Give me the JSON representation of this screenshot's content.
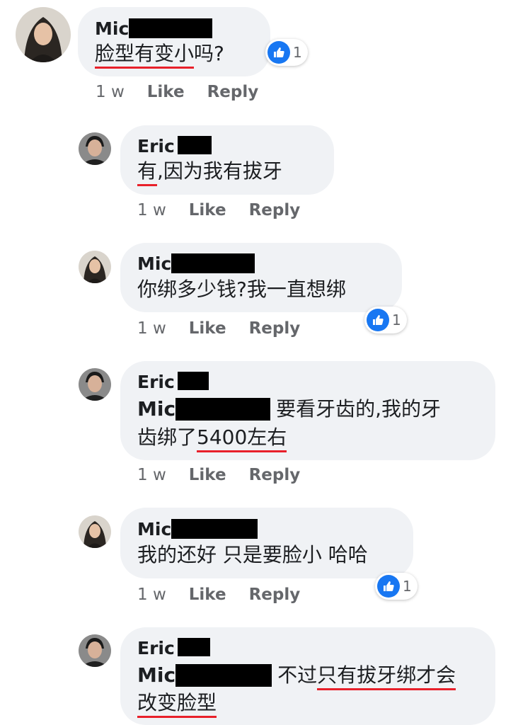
{
  "comments": [
    {
      "author": "Mic",
      "text_parts": [
        "脸型有变小",
        "吗?"
      ],
      "time": "1 w",
      "like": "Like",
      "reply": "Reply",
      "reactions": "1"
    },
    {
      "author": "Eric",
      "text_parts": [
        "有",
        ",因为我有拔牙"
      ],
      "time": "1 w",
      "like": "Like",
      "reply": "Reply"
    },
    {
      "author": "Mic",
      "text": "你绑多少钱?我一直想绑",
      "time": "1 w",
      "like": "Like",
      "reply": "Reply",
      "reactions": "1"
    },
    {
      "author": "Eric",
      "mention": "Mic",
      "line1": "要看牙齿的,我的牙",
      "line2_plain": "齿绑了",
      "line2_ul": "5400左右",
      "time": "1 w",
      "like": "Like",
      "reply": "Reply"
    },
    {
      "author": "Mic",
      "text": "我的还好 只是要脸小 哈哈",
      "time": "1 w",
      "like": "Like",
      "reply": "Reply",
      "reactions": "1"
    },
    {
      "author": "Eric",
      "mention": "Mic",
      "line1_plain": "不过",
      "line1_ul": "只有拔牙绑才会",
      "line2_ul": "改变脸型"
    }
  ],
  "colors": {
    "like_blue": "#1877f2",
    "underline_red": "#e8202a",
    "bubble": "#f0f2f5",
    "meta": "#65676b"
  },
  "icons": [
    "avatar-mic",
    "avatar-eric",
    "like-reaction-icon"
  ]
}
